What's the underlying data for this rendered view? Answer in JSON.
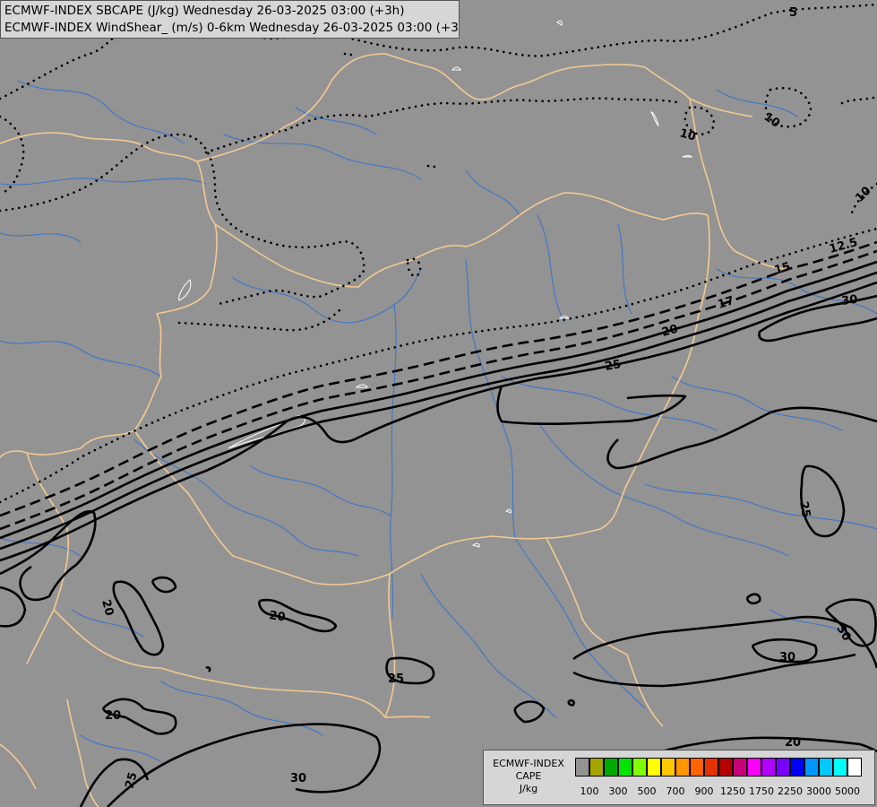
{
  "header": {
    "line1": "ECMWF-INDEX SBCAPE (J/kg) Wednesday 26-03-2025 03:00 (+3h)",
    "line2": "ECMWF-INDEX WindShear_ (m/s) 0-6km Wednesday 26-03-2025 03:00 (+3h)"
  },
  "map": {
    "background": "#939393",
    "border_color": "#f3c992",
    "river_color": "#3f76c8",
    "contour_color": "#000000",
    "contour_labels": [
      {
        "id": "5",
        "text": "5"
      },
      {
        "id": "10a",
        "text": "10"
      },
      {
        "id": "10b",
        "text": "10"
      },
      {
        "id": "10c",
        "text": "10"
      },
      {
        "id": "12-5",
        "text": "12.5"
      },
      {
        "id": "15",
        "text": "15"
      },
      {
        "id": "17",
        "text": "17"
      },
      {
        "id": "20a",
        "text": "20"
      },
      {
        "id": "25a",
        "text": "25"
      },
      {
        "id": "30a",
        "text": "30"
      },
      {
        "id": "25b",
        "text": "25"
      },
      {
        "id": "20b",
        "text": "20"
      },
      {
        "id": "20c",
        "text": "20"
      },
      {
        "id": "25c",
        "text": "25"
      },
      {
        "id": "20d",
        "text": "20"
      },
      {
        "id": "30b",
        "text": "30"
      },
      {
        "id": "30c",
        "text": "30"
      },
      {
        "id": "20e",
        "text": "20"
      },
      {
        "id": "30d",
        "text": "30"
      },
      {
        "id": "25d",
        "text": "25"
      }
    ]
  },
  "legend": {
    "title_lines": [
      "ECMWF-INDEX",
      "CAPE",
      "J/kg"
    ],
    "colors": [
      "#939393",
      "#a5a500",
      "#00aa00",
      "#00e400",
      "#7fff00",
      "#ffff00",
      "#ffc800",
      "#ff9600",
      "#ff6400",
      "#e43200",
      "#b40000",
      "#c80078",
      "#ff00ff",
      "#b400ff",
      "#7800ff",
      "#0000ff",
      "#0096ff",
      "#00c8ff",
      "#00ffff",
      "#ffffff"
    ],
    "ticks": [
      "100",
      "300",
      "500",
      "700",
      "900",
      "1250",
      "1750",
      "2250",
      "3000",
      "5000"
    ]
  }
}
